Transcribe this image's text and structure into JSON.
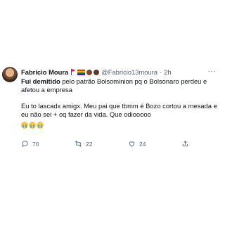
{
  "tweet": {
    "author_name": "Fabrício Moura",
    "handle": "@Fabricio13moura",
    "separator": "·",
    "time": "2h",
    "more": "···",
    "lead_bold": "Fui demitido",
    "lead_rest": " pelo patrão Bolsominion pq o Bolsonaro perdeu e afetou a empresa",
    "paragraph2": "Eu to lascadx amigx. Meu pai que tbmm é Bozo cortou a mesada e eu não sei + oq fazer da vida. Que odiooooo",
    "reaction_icons": [
      "crying-face",
      "crying-face",
      "crying-face"
    ],
    "header_emoji_icons": [
      "red-flag",
      "rainbow-flag",
      "brown-circle",
      "dark-circle"
    ]
  },
  "actions": {
    "replies": "70",
    "retweets": "22",
    "likes": "24"
  },
  "colors": {
    "text": "#0f1419",
    "secondary": "#536471",
    "background": "#ffffff"
  }
}
